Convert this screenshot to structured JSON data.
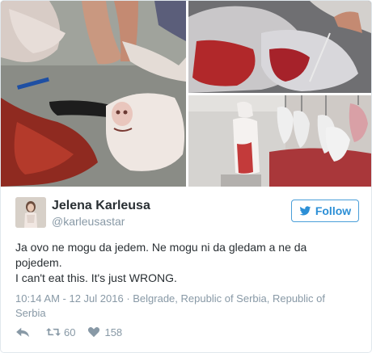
{
  "tweet": {
    "author": {
      "name": "Jelena Karleusa",
      "handle": "@karleusastar"
    },
    "follow_label": "Follow",
    "text_lines": [
      "Ja ovo ne mogu da jedem. Ne mogu ni da gledam a ne da",
      "pojedem.",
      "I can't eat this. It's just WRONG."
    ],
    "meta_line_1": "10:14 AM - 12 Jul 2016 · Belgrade, Republic of Serbia, Republic of",
    "meta_line_2": "Serbia",
    "retweets": "60",
    "likes": "158"
  },
  "icons": {
    "reply": "reply-icon",
    "retweet": "retweet-icon",
    "like": "heart-icon",
    "follow": "bird-icon"
  },
  "colors": {
    "accent": "#2c8fd6",
    "muted": "#8899a6",
    "text": "#292f33",
    "border": "#e1e8ed"
  }
}
